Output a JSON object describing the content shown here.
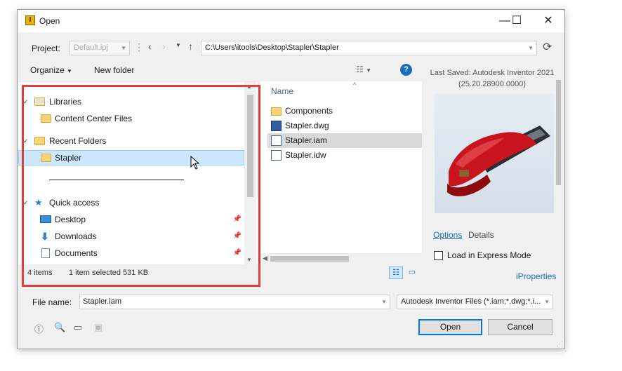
{
  "window": {
    "title": "Open",
    "minimize_glyph": "—",
    "maximize_glyph": "☐",
    "close_glyph": "✕"
  },
  "project": {
    "label": "Project:",
    "value": "Default.ipj",
    "path": "C:\\Users\\itools\\Desktop\\Stapler\\Stapler"
  },
  "toolbar": {
    "organize": "Organize",
    "new_folder": "New folder"
  },
  "nav": {
    "libraries": "Libraries",
    "content_center": "Content Center Files",
    "recent_folders": "Recent Folders",
    "stapler": "Stapler",
    "quick_access": "Quick access",
    "desktop": "Desktop",
    "downloads": "Downloads",
    "documents": "Documents"
  },
  "files": {
    "column_name": "Name",
    "items": [
      {
        "name": "Components",
        "icon": "folder-icon"
      },
      {
        "name": "Stapler.dwg",
        "icon": "dwg-file-icon"
      },
      {
        "name": "Stapler.iam",
        "icon": "iam-file-icon"
      },
      {
        "name": "Stapler.idw",
        "icon": "idw-file-icon"
      }
    ]
  },
  "status": {
    "count": "4 items",
    "selected": "1 item selected  531 KB"
  },
  "preview": {
    "saved_line1": "Last Saved: Autodesk Inventor 2021",
    "saved_line2": "(25.20.28900.0000)",
    "tab_options": "Options",
    "tab_details": "Details",
    "express_mode": "Load in Express Mode",
    "iproperties": "iProperties"
  },
  "bottom": {
    "filename_label": "File name:",
    "filename_value": "Stapler.iam",
    "filetype": "Autodesk Inventor Files (*.iam;*.dwg;*.i...",
    "open": "Open",
    "cancel": "Cancel"
  },
  "colors": {
    "highlight": "#e03d3d",
    "link": "#1a6dbd",
    "selection": "#cce8ff"
  }
}
